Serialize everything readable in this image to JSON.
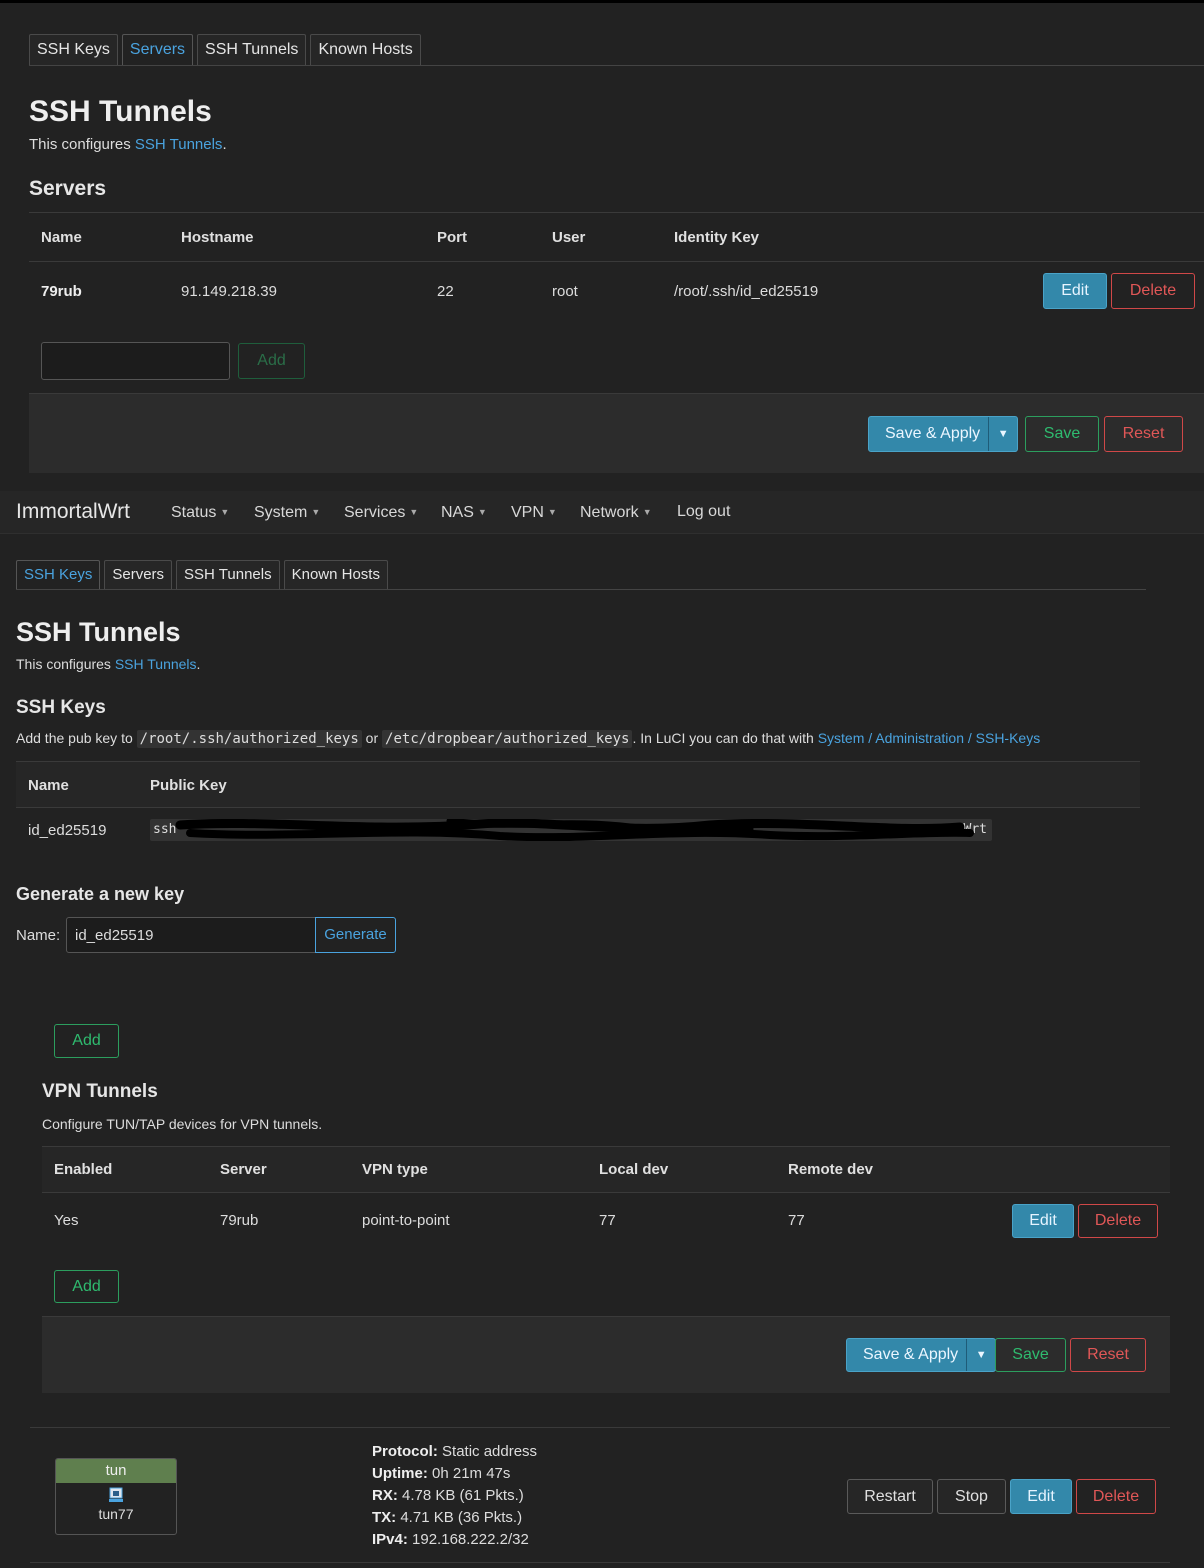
{
  "top": {
    "tabs": [
      "SSH Keys",
      "Servers",
      "SSH Tunnels",
      "Known Hosts"
    ],
    "active_tab": 1,
    "title": "SSH Tunnels",
    "description_prefix": "This configures ",
    "description_link": "SSH Tunnels",
    "description_suffix": ".",
    "section_title": "Servers",
    "columns": [
      "Name",
      "Hostname",
      "Port",
      "User",
      "Identity Key"
    ],
    "rows": [
      {
        "name": "79rub",
        "hostname": "91.149.218.39",
        "port": "22",
        "user": "root",
        "identity_key": "/root/.ssh/id_ed25519"
      }
    ],
    "edit_label": "Edit",
    "delete_label": "Delete",
    "add_label": "Add",
    "new_name_value": "",
    "save_apply_label": "Save & Apply",
    "save_label": "Save",
    "reset_label": "Reset"
  },
  "navbar": {
    "brand": "ImmortalWrt",
    "items": [
      "Status",
      "System",
      "Services",
      "NAS",
      "VPN",
      "Network"
    ],
    "logout": "Log out"
  },
  "keys_page": {
    "tabs": [
      "SSH Keys",
      "Servers",
      "SSH Tunnels",
      "Known Hosts"
    ],
    "active_tab": 0,
    "title": "SSH Tunnels",
    "description_prefix": "This configures ",
    "description_link": "SSH Tunnels",
    "description_suffix": ".",
    "section_title": "SSH Keys",
    "hint_prefix": "Add the pub key to ",
    "hint_path1": "/root/.ssh/authorized_keys",
    "hint_or": " or ",
    "hint_path2": "/etc/dropbear/authorized_keys",
    "hint_mid": ". In LuCI you can do that with ",
    "hint_link": "System / Administration / SSH-Keys",
    "columns": [
      "Name",
      "Public Key"
    ],
    "rows": [
      {
        "name": "id_ed25519",
        "key_start": "ssh",
        "key_end": "tWrt"
      }
    ],
    "generate_title": "Generate a new key",
    "name_label": "Name:",
    "name_value": "id_ed25519",
    "generate_label": "Generate"
  },
  "vpn": {
    "add_top_label": "Add",
    "title": "VPN Tunnels",
    "description": "Configure TUN/TAP devices for VPN tunnels.",
    "columns": [
      "Enabled",
      "Server",
      "VPN type",
      "Local dev",
      "Remote dev"
    ],
    "rows": [
      {
        "enabled": "Yes",
        "server": "79rub",
        "vpn_type": "point-to-point",
        "local_dev": "77",
        "remote_dev": "77"
      }
    ],
    "edit_label": "Edit",
    "delete_label": "Delete",
    "add_label": "Add",
    "save_apply_label": "Save & Apply",
    "save_label": "Save",
    "reset_label": "Reset"
  },
  "interface": {
    "name": "tun",
    "device": "tun77",
    "icon": "network-port-icon",
    "header_color": "#5f7f4e",
    "protocol_label": "Protocol:",
    "protocol": "Static address",
    "uptime_label": "Uptime:",
    "uptime": "0h 21m 47s",
    "rx_label": "RX:",
    "rx": "4.78 KB (61 Pkts.)",
    "tx_label": "TX:",
    "tx": "4.71 KB (36 Pkts.)",
    "ipv4_label": "IPv4:",
    "ipv4": "192.168.222.2/32",
    "restart_label": "Restart",
    "stop_label": "Stop",
    "edit_label": "Edit",
    "delete_label": "Delete"
  },
  "colors": {
    "background": "#222222",
    "accent": "#4aa3df",
    "primary_button": "#3388aa",
    "positive": "#2fbb6f",
    "negative": "#e05757"
  }
}
